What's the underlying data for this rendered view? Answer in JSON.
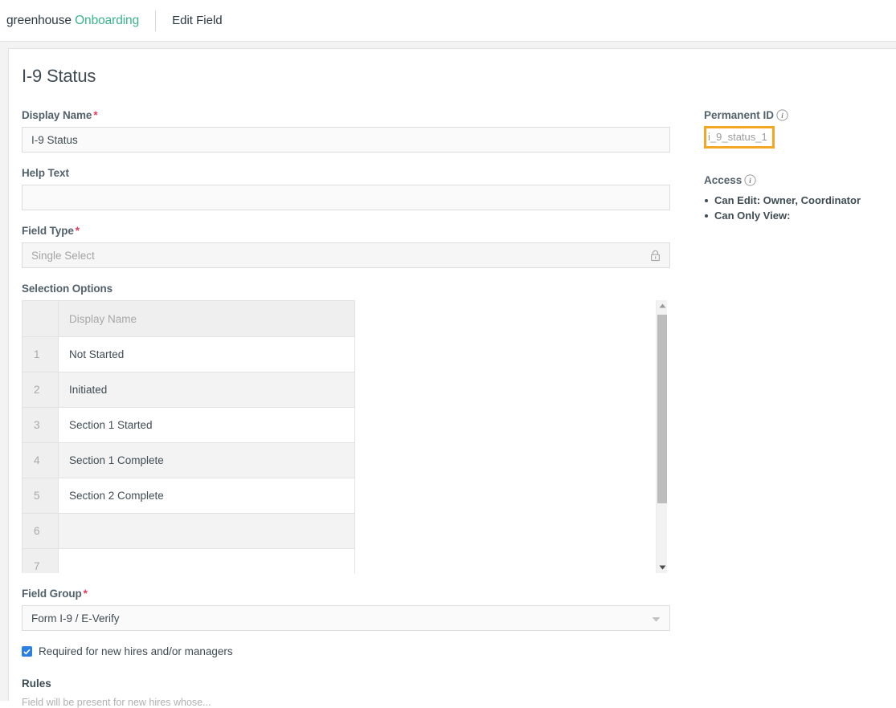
{
  "topbar": {
    "brand_primary": "greenhouse",
    "brand_secondary": "Onboarding",
    "breadcrumb": "Edit Field"
  },
  "page": {
    "title": "I-9 Status"
  },
  "form": {
    "display_name": {
      "label": "Display Name",
      "required_marker": "*",
      "value": "I-9 Status"
    },
    "help_text": {
      "label": "Help Text",
      "value": "",
      "placeholder": ""
    },
    "field_type": {
      "label": "Field Type",
      "required_marker": "*",
      "value": "Single Select",
      "locked": true,
      "lock_icon": "lock-icon"
    },
    "selection_options": {
      "label": "Selection Options",
      "columns": [
        "",
        "Display Name"
      ],
      "rows": [
        {
          "num": "1",
          "display_name": "Not Started"
        },
        {
          "num": "2",
          "display_name": "Initiated"
        },
        {
          "num": "3",
          "display_name": "Section 1 Started"
        },
        {
          "num": "4",
          "display_name": "Section 1 Complete"
        },
        {
          "num": "5",
          "display_name": "Section 2 Complete"
        },
        {
          "num": "6",
          "display_name": ""
        },
        {
          "num": "7",
          "display_name": ""
        }
      ],
      "scrollbar": {
        "up_icon": "caret-up-icon",
        "down_icon": "caret-down-icon"
      }
    },
    "field_group": {
      "label": "Field Group",
      "required_marker": "*",
      "value": "Form I-9 / E-Verify",
      "chevron_icon": "chevron-down-icon"
    },
    "required_checkbox": {
      "label": "Required for new hires and/or managers",
      "checked": true
    },
    "rules": {
      "heading": "Rules",
      "description": "Field will be present for new hires whose..."
    }
  },
  "sidebar": {
    "permanent_id": {
      "label": "Permanent ID",
      "info_icon": "info-icon",
      "value": "i_9_status_1",
      "highlight_color": "#f5a623"
    },
    "access": {
      "label": "Access",
      "info_icon": "info-icon",
      "items": [
        "Can Edit: Owner, Coordinator",
        "Can Only View:"
      ]
    }
  },
  "colors": {
    "brand_green": "#3ab28c",
    "required_red": "#e8385a",
    "checkbox_blue": "#2a7fe0",
    "highlight_orange": "#f5a623",
    "text_dark": "#3f4c54"
  }
}
